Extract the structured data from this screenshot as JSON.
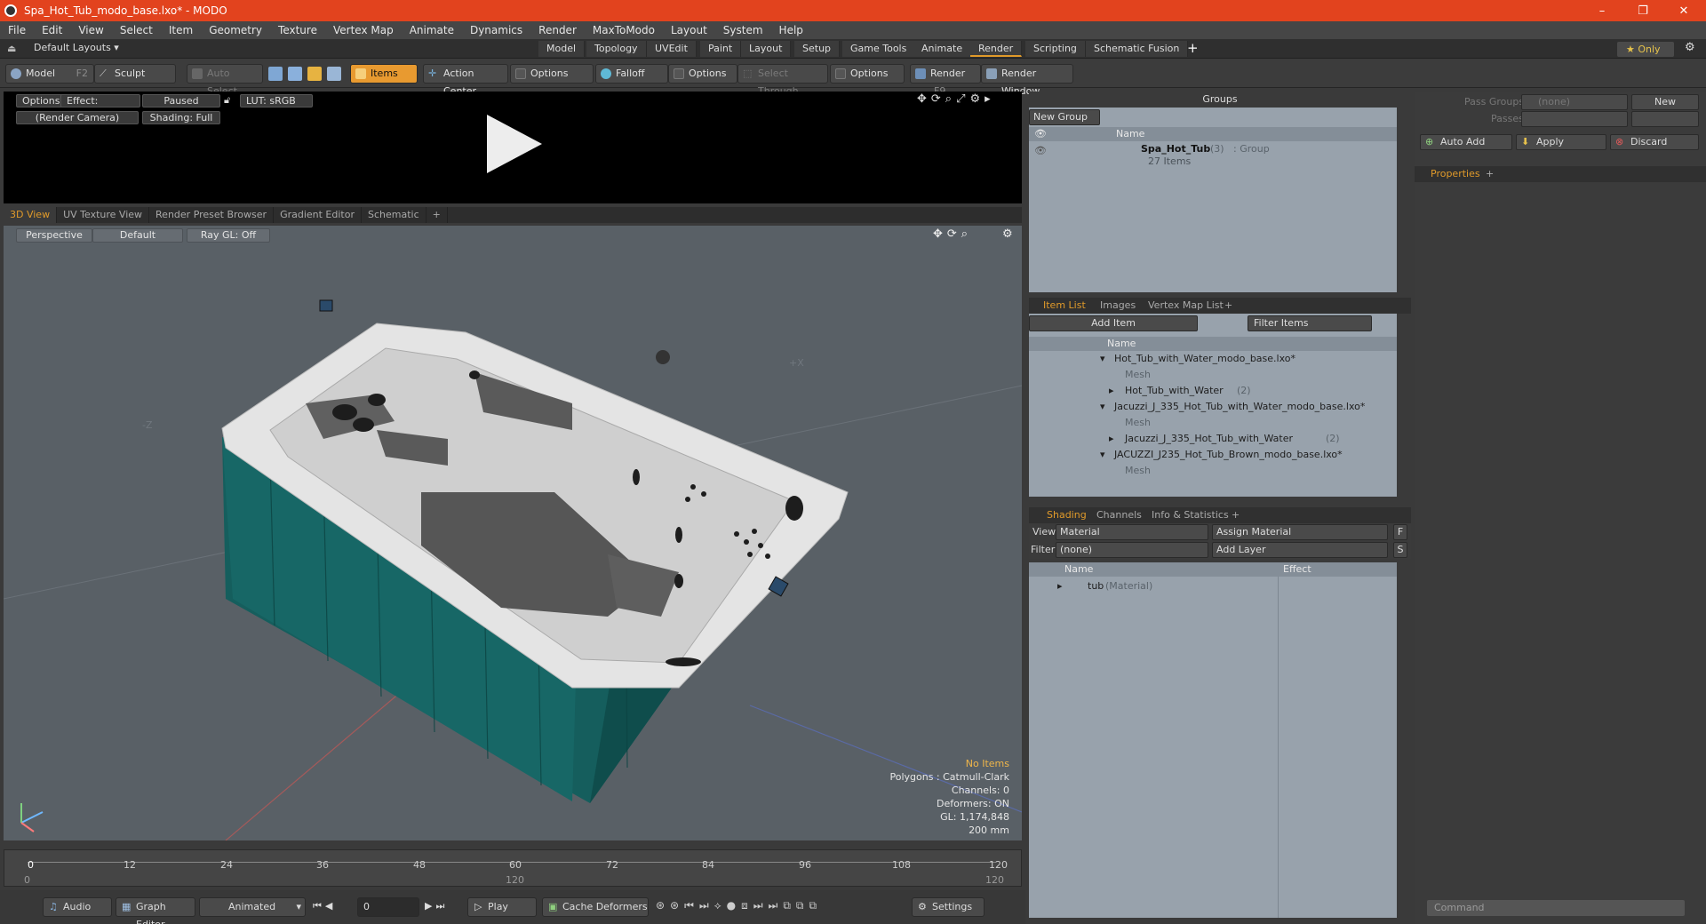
{
  "window": {
    "title": "Spa_Hot_Tub_modo_base.lxo* - MODO",
    "controls": [
      "–",
      "❐",
      "✕"
    ]
  },
  "menu": [
    "File",
    "Edit",
    "View",
    "Select",
    "Item",
    "Geometry",
    "Texture",
    "Vertex Map",
    "Animate",
    "Dynamics",
    "Render",
    "MaxToModo",
    "Layout",
    "System",
    "Help"
  ],
  "layouts": {
    "selector": "Default Layouts ▾",
    "tabs": [
      "Model",
      "Topology",
      "UVEdit",
      "Paint",
      "Layout",
      "Setup",
      "Game Tools",
      "Animate",
      "Render",
      "Scripting",
      "Schematic Fusion"
    ],
    "active": "Render",
    "add": "+",
    "only": "★  Only"
  },
  "toolbar": {
    "model": "Model",
    "model_key": "F2",
    "sculpt": "Sculpt",
    "auto_select": "Auto Select",
    "items": "Items",
    "action_center": "Action Center",
    "options1": "Options",
    "falloff": "Falloff",
    "options2": "Options",
    "select_through": "Select Through",
    "options3": "Options",
    "render": "Render",
    "render_key": "F9",
    "render_window": "Render Window"
  },
  "preview": {
    "options": "Options",
    "effect": "Effect: (Shadi...",
    "status": "Paused",
    "lut": "LUT: sRGB",
    "camera": "(Render Camera)",
    "shading": "Shading: Full"
  },
  "viewport_tabs": [
    "3D View",
    "UV Texture View",
    "Render Preset Browser",
    "Gradient Editor",
    "Schematic",
    "+"
  ],
  "viewport": {
    "projection": "Perspective",
    "style": "Default",
    "raygl": "Ray GL: Off",
    "axis_x": "+X",
    "axis_z": "-Z",
    "stats": {
      "items": "No Items",
      "polygons": "Polygons : Catmull-Clark",
      "channels": "Channels: 0",
      "deformers": "Deformers: ON",
      "gl": "GL: 1,174,848",
      "scale": "200 mm"
    }
  },
  "timeline": {
    "ticks": [
      "0",
      "12",
      "24",
      "36",
      "48",
      "60",
      "72",
      "84",
      "96",
      "108",
      "120"
    ],
    "sub": [
      "0",
      "120",
      "120"
    ]
  },
  "bottom": {
    "audio": "Audio",
    "graph_editor": "Graph Editor",
    "animated": "Animated",
    "frame": "0",
    "play": "Play",
    "cache": "Cache Deformers",
    "settings": "Settings"
  },
  "groups": {
    "title": "Groups",
    "new_group": "New Group",
    "col_name": "Name",
    "item_name": "Spa_Hot_Tub",
    "item_count": "(3)",
    "item_type": ": Group",
    "item_sub": "27 Items"
  },
  "pass": {
    "pass_groups": "Pass Groups",
    "passes": "Passes",
    "none": "(none)",
    "new": "New",
    "auto_add": "Auto Add",
    "apply": "Apply",
    "discard": "Discard",
    "properties": "Properties",
    "add": "+"
  },
  "item_list": {
    "tabs": [
      "Item List",
      "Images",
      "Vertex Map List",
      "+"
    ],
    "add_item": "Add Item",
    "filter": "Filter Items",
    "col_name": "Name",
    "rows": [
      {
        "label": "Hot_Tub_with_Water_modo_base.lxo*",
        "indent": 0,
        "kind": "scene"
      },
      {
        "label": "Mesh",
        "indent": 1,
        "kind": "mesh"
      },
      {
        "label": "Hot_Tub_with_Water",
        "count": "(2)",
        "indent": 1,
        "kind": "locator"
      },
      {
        "label": "Jacuzzi_J_335_Hot_Tub_with_Water_modo_base.lxo*",
        "indent": 0,
        "kind": "scene"
      },
      {
        "label": "Mesh",
        "indent": 1,
        "kind": "mesh"
      },
      {
        "label": "Jacuzzi_J_335_Hot_Tub_with_Water",
        "count": "(2)",
        "indent": 1,
        "kind": "locator"
      },
      {
        "label": "JACUZZI_J235_Hot_Tub_Brown_modo_base.lxo*",
        "indent": 0,
        "kind": "scene"
      },
      {
        "label": "Mesh",
        "indent": 1,
        "kind": "mesh"
      }
    ]
  },
  "shading": {
    "tabs": [
      "Shading",
      "Channels",
      "Info & Statistics",
      "+"
    ],
    "view_label": "View",
    "view_value": "Material",
    "assign": "Assign Material",
    "filter_label": "Filter",
    "filter_value": "(none)",
    "add_layer": "Add Layer",
    "col_name": "Name",
    "col_effect": "Effect",
    "row_name": "tub",
    "row_type": "(Material)",
    "f": "F",
    "s": "S"
  },
  "command": {
    "placeholder": "Command"
  }
}
